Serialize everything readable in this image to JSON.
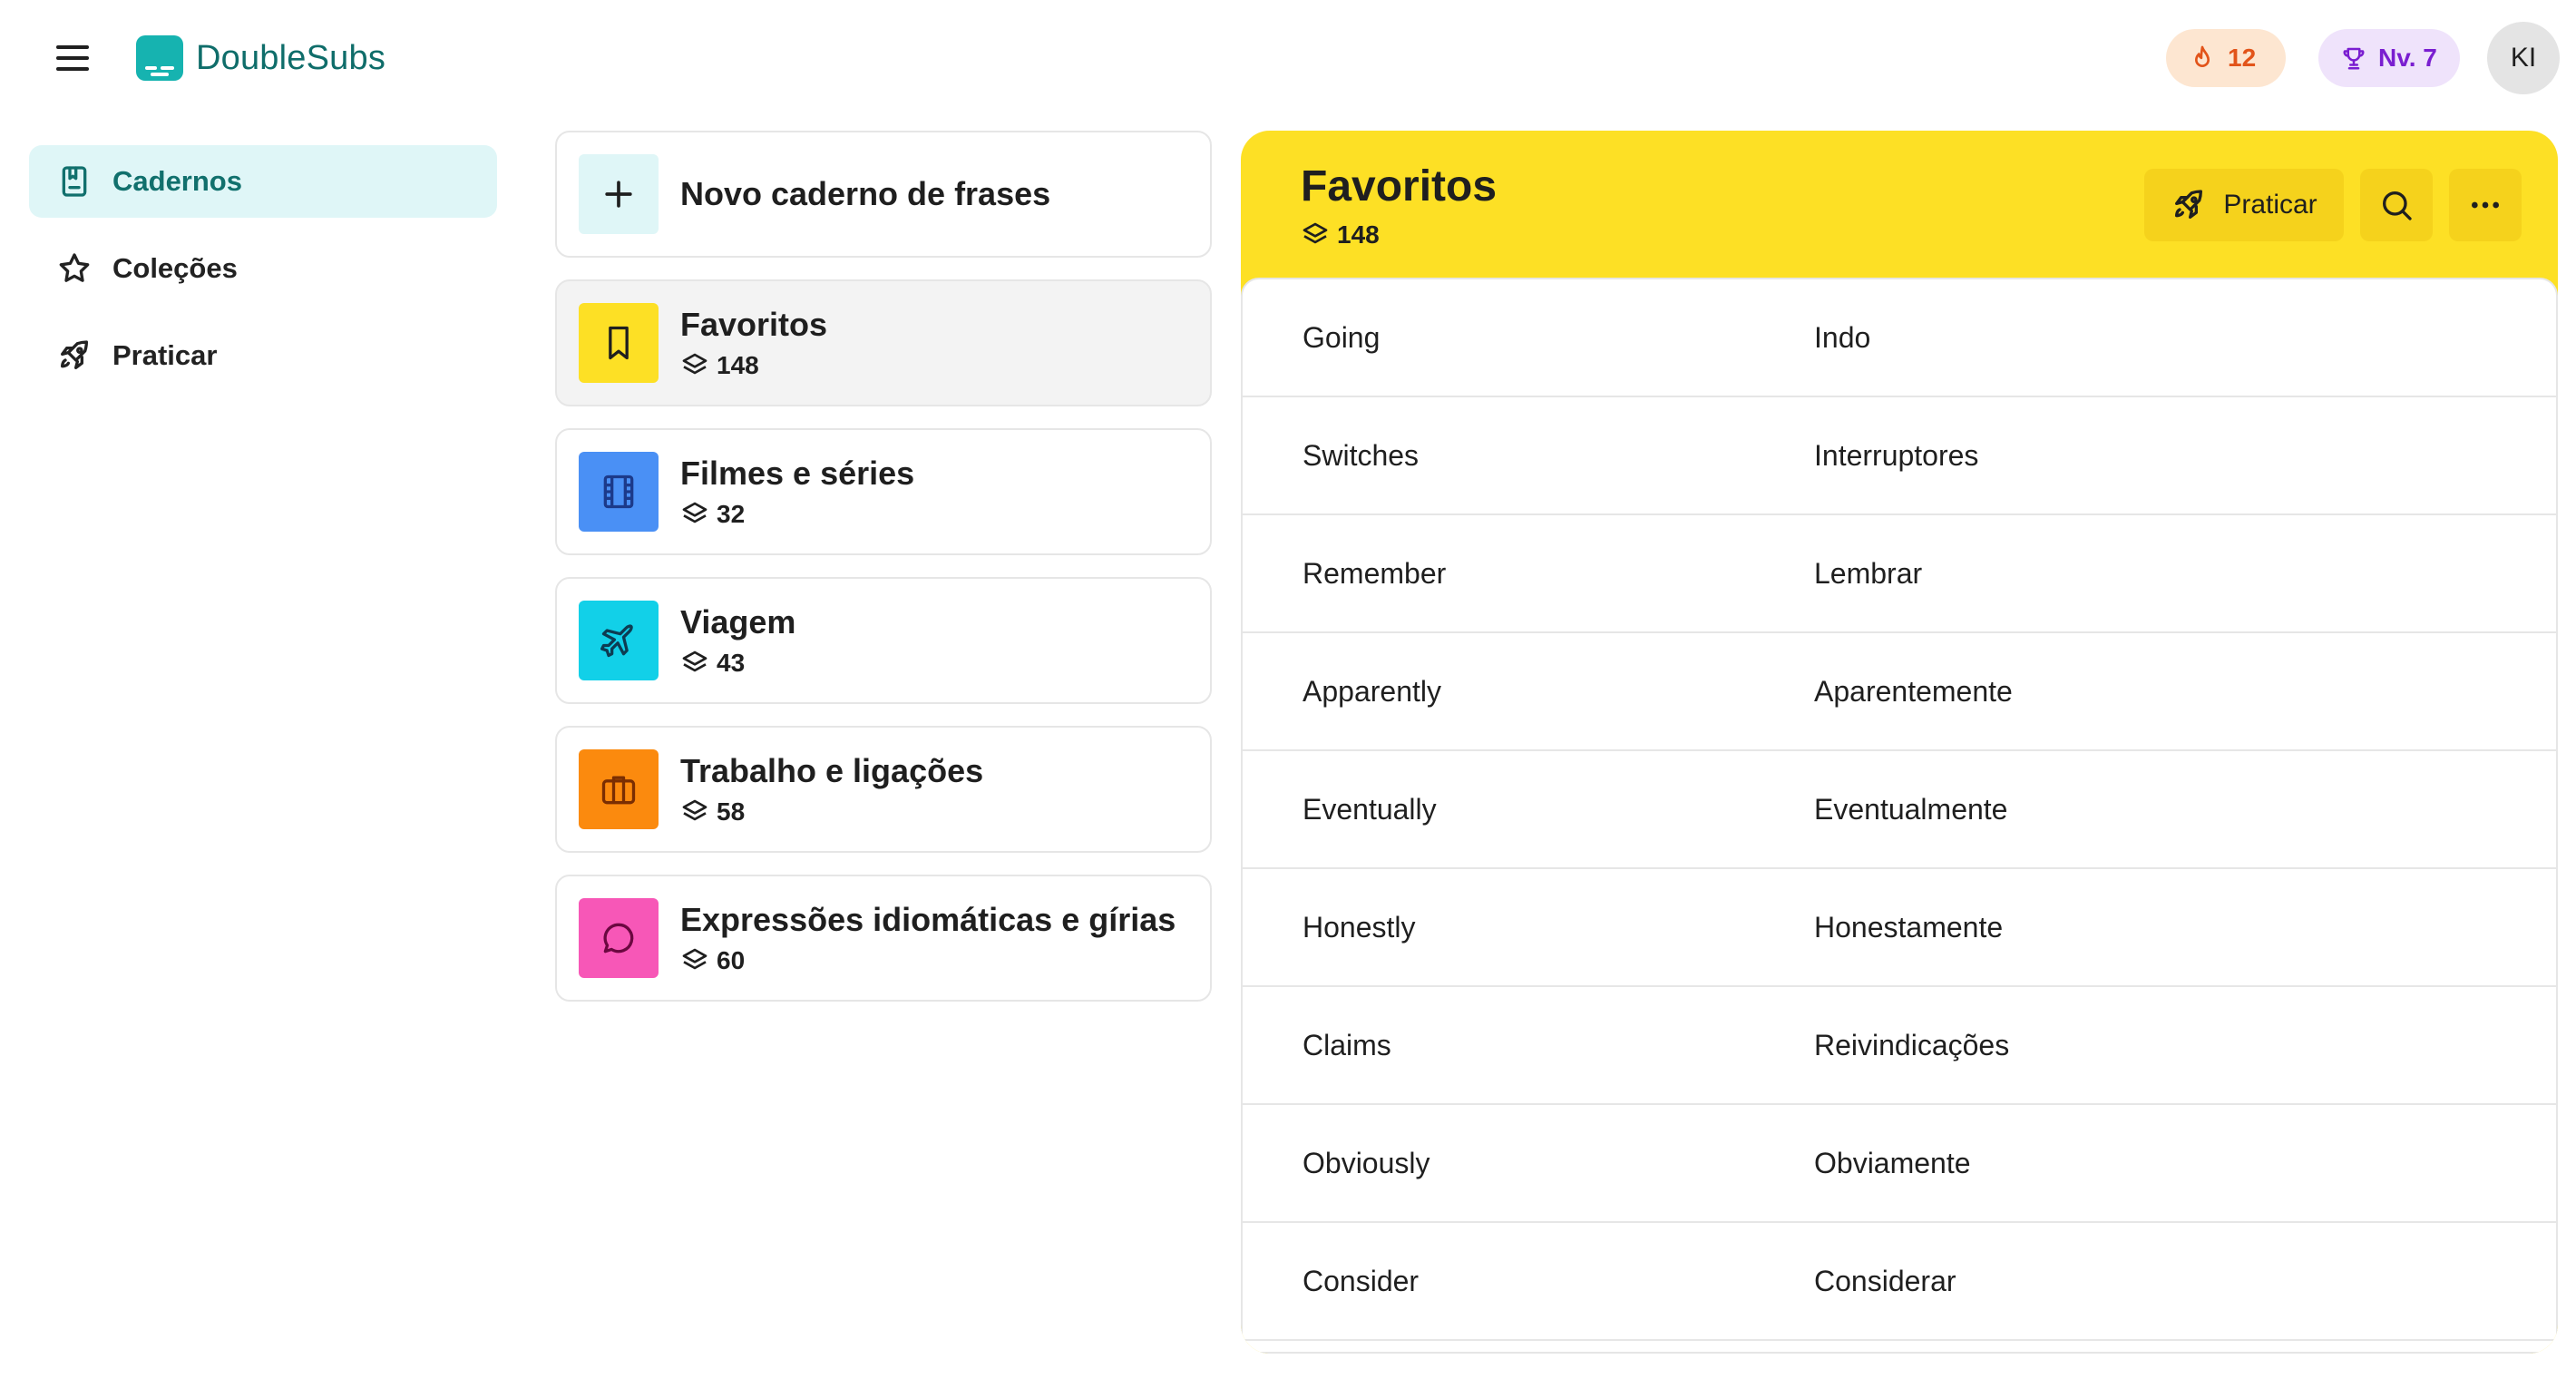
{
  "header": {
    "menu_icon": "hamburger-icon",
    "app_name": "DoubleSubs",
    "streak": {
      "icon": "flame-icon",
      "value": "12",
      "color": "#e2541a"
    },
    "level": {
      "icon": "trophy-icon",
      "label": "Nv. 7",
      "color": "#7a1ed0"
    },
    "avatar_initials": "KI"
  },
  "sidebar": {
    "items": [
      {
        "label": "Cadernos",
        "icon": "notebook-icon",
        "active": true
      },
      {
        "label": "Coleções",
        "icon": "star-icon",
        "active": false
      },
      {
        "label": "Praticar",
        "icon": "rocket-icon",
        "active": false
      }
    ]
  },
  "notebooks": {
    "new_label": "Novo caderno de frases",
    "items": [
      {
        "name": "Favoritos",
        "count": "148",
        "icon": "bookmark-icon",
        "color": "#fde025",
        "selected": true
      },
      {
        "name": "Filmes e séries",
        "count": "32",
        "icon": "film-icon",
        "color": "#4a90f5",
        "selected": false
      },
      {
        "name": "Viagem",
        "count": "43",
        "icon": "plane-icon",
        "color": "#12d0e8",
        "selected": false
      },
      {
        "name": "Trabalho e ligações",
        "count": "58",
        "icon": "briefcase-icon",
        "color": "#fb8a0e",
        "selected": false
      },
      {
        "name": "Expressões idiomáticas e gírias",
        "count": "60",
        "icon": "chat-bubble-icon",
        "color": "#f757b7",
        "selected": false
      }
    ]
  },
  "detail": {
    "title": "Favoritos",
    "count": "148",
    "accent_color": "#fde025",
    "practice_label": "Praticar",
    "phrases": [
      {
        "term": "Going",
        "translation": "Indo"
      },
      {
        "term": "Switches",
        "translation": "Interruptores"
      },
      {
        "term": "Remember",
        "translation": "Lembrar"
      },
      {
        "term": "Apparently",
        "translation": "Aparentemente"
      },
      {
        "term": "Eventually",
        "translation": "Eventualmente"
      },
      {
        "term": "Honestly",
        "translation": "Honestamente"
      },
      {
        "term": "Claims",
        "translation": "Reivindicações"
      },
      {
        "term": "Obviously",
        "translation": "Obviamente"
      },
      {
        "term": "Consider",
        "translation": "Considerar"
      }
    ]
  }
}
